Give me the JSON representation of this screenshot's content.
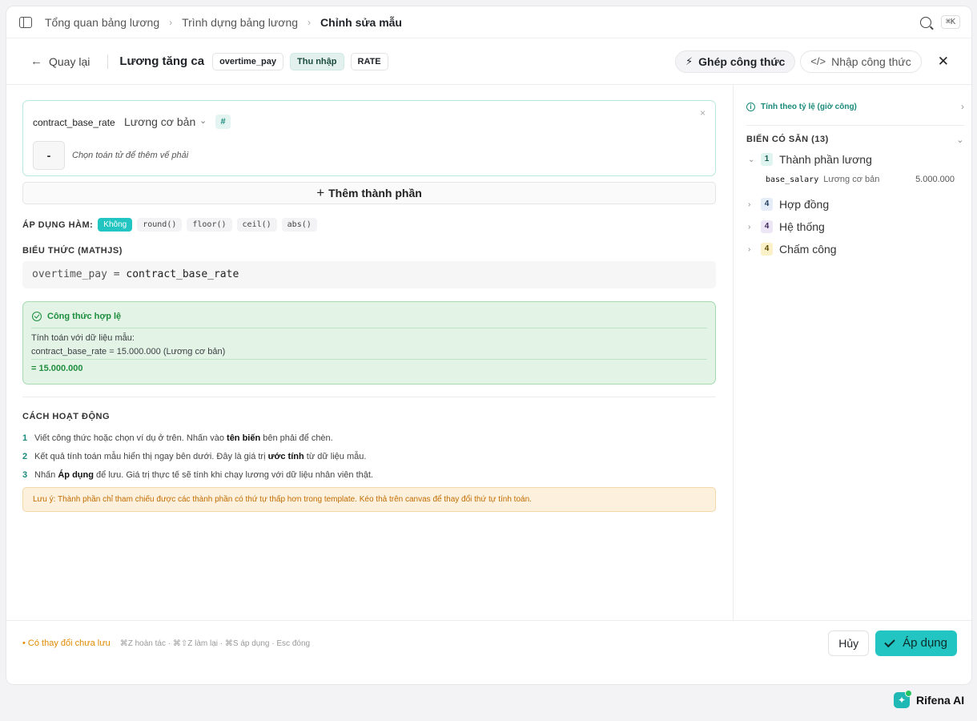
{
  "breadcrumb": {
    "items": [
      "Tổng quan bảng lương",
      "Trình dựng bảng lương"
    ],
    "current": "Chỉnh sửa mẫu"
  },
  "search": {
    "shortcut": "⌘K"
  },
  "header": {
    "back_label": "Quay lại",
    "title": "Lương tăng ca",
    "tags": [
      "overtime_pay",
      "Thu nhập",
      "RATE"
    ],
    "compose_label": "Ghép công thức",
    "input_label": "Nhập công thức"
  },
  "component": {
    "variable": "contract_base_rate",
    "label": "Lương cơ bản",
    "type_symbol": "#",
    "close": "×",
    "operator": "-",
    "operator_hint": "Chọn toán tử để thêm vế phải"
  },
  "add_component_label": "Thêm thành phần",
  "apply_function": {
    "label": "ÁP DỤNG HÀM:",
    "options": [
      "Không",
      "round()",
      "floor()",
      "ceil()",
      "abs()"
    ],
    "selected": "Không"
  },
  "expression": {
    "label": "BIỂU THỨC (MATHJS)",
    "lhs": "overtime_pay =",
    "rhs": "contract_base_rate"
  },
  "validation": {
    "title": "Công thức hợp lệ",
    "sample_label": "Tính toán với dữ liệu mẫu:",
    "sample_detail": "contract_base_rate = 15.000.000 (Lương cơ bản)",
    "result": "= 15.000.000"
  },
  "how_it_works": {
    "label": "CÁCH HOẠT ĐỘNG",
    "steps": [
      {
        "num": "1",
        "a": "Viết công thức hoặc chọn ví dụ ở trên. Nhấn vào ",
        "b": "tên biến",
        "c": " bên phải để chèn."
      },
      {
        "num": "2",
        "a": "Kết quả tính toán mẫu hiển thị ngay bên dưới. Đây là giá trị ",
        "b": "ước tính",
        "c": " từ dữ liệu mẫu."
      },
      {
        "num": "3",
        "a": "Nhấn ",
        "b": "Áp dụng",
        "c": " để lưu. Giá trị thực tế sẽ tính khi chạy lương với dữ liệu nhân viên thật."
      }
    ],
    "note": "Lưu ý: Thành phần chỉ tham chiếu được các thành phần có thứ tự thấp hơn trong template. Kéo thả trên canvas để thay đổi thứ tự tính toán."
  },
  "footer": {
    "unsaved": "• Có thay đổi chưa lưu",
    "shortcuts": "⌘Z hoàn tác · ⌘⇧Z làm lại · ⌘S áp dụng · Esc đóng",
    "cancel_label": "Hủy",
    "apply_label": "Áp dụng"
  },
  "sidebar": {
    "ratio_label": "Tính theo tỷ lệ (giờ công)",
    "vars_header": "BIẾN CÓ SẴN (13)",
    "groups": [
      {
        "count": "1",
        "name": "Thành phần lương",
        "expanded": true
      },
      {
        "count": "4",
        "name": "Hợp đồng",
        "expanded": false
      },
      {
        "count": "4",
        "name": "Hệ thống",
        "expanded": false
      },
      {
        "count": "4",
        "name": "Chấm công",
        "expanded": false
      }
    ],
    "variable": {
      "key": "base_salary",
      "desc": "Lương cơ bản",
      "value": "5.000.000"
    }
  },
  "ai": {
    "label": "Rifena AI"
  },
  "colors": {
    "accent": "#22c5c1",
    "valid_bg": "#e3f3e6",
    "valid_text": "#1e8e3e",
    "warning_bg": "#fdf1dd",
    "warning_text": "#c16c00"
  }
}
